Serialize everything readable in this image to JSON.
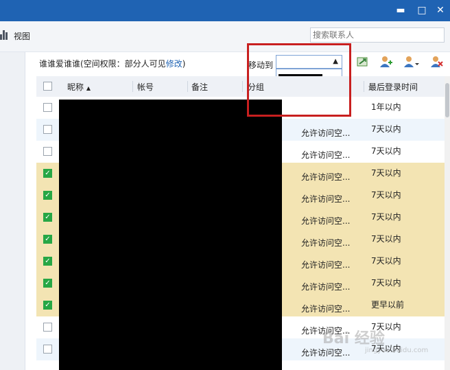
{
  "window": {
    "minimize_glyph": "▬",
    "maximize_glyph": "□",
    "close_glyph": "✕"
  },
  "toolbar": {
    "view_label": "视图",
    "search_placeholder": "搜索联系人"
  },
  "group": {
    "title_prefix": "谁谁爱谁谁(空间权限：部分人可见",
    "edit_link": "修改",
    "title_suffix": ")",
    "move_to_label": "移动到"
  },
  "table": {
    "columns": {
      "nickname": "昵称",
      "sort_glyph": "▲",
      "account": "帐号",
      "remark": "备注",
      "group": "分组",
      "last_login": "最后登录时间"
    },
    "rows": [
      {
        "checked": false,
        "permission": "",
        "last_login": "1年以内",
        "bg": "#ffffff"
      },
      {
        "checked": false,
        "permission": "允许访问空...",
        "last_login": "7天以内",
        "bg": "#eef5fc"
      },
      {
        "checked": false,
        "permission": "允许访问空...",
        "last_login": "7天以内",
        "bg": "#ffffff"
      },
      {
        "checked": true,
        "permission": "允许访问空...",
        "last_login": "7天以内",
        "bg": "#f3e4b3"
      },
      {
        "checked": true,
        "permission": "允许访问空...",
        "last_login": "7天以内",
        "bg": "#f3e4b3"
      },
      {
        "checked": true,
        "permission": "允许访问空...",
        "last_login": "7天以内",
        "bg": "#f3e4b3"
      },
      {
        "checked": true,
        "permission": "允许访问空...",
        "last_login": "7天以内",
        "bg": "#f3e4b3"
      },
      {
        "checked": true,
        "permission": "允许访问空...",
        "last_login": "7天以内",
        "bg": "#f3e4b3"
      },
      {
        "checked": true,
        "permission": "允许访问空...",
        "last_login": "7天以内",
        "bg": "#f3e4b3"
      },
      {
        "checked": true,
        "permission": "允许访问空...",
        "last_login": "更早以前",
        "bg": "#f3e4b3"
      },
      {
        "checked": false,
        "permission": "允许访问空...",
        "last_login": "7天以内",
        "bg": "#ffffff"
      },
      {
        "checked": false,
        "permission": "允许访问空...",
        "last_login": "7天以内",
        "bg": "#eef5fc"
      }
    ]
  },
  "watermark": {
    "text": "Bai 经验",
    "sub": "jingyan.baidu.com"
  },
  "colors": {
    "titlebar": "#1f63b3",
    "link": "#1f63b3",
    "selected_row": "#f3e4b3",
    "highlight": "#c81f1f"
  }
}
